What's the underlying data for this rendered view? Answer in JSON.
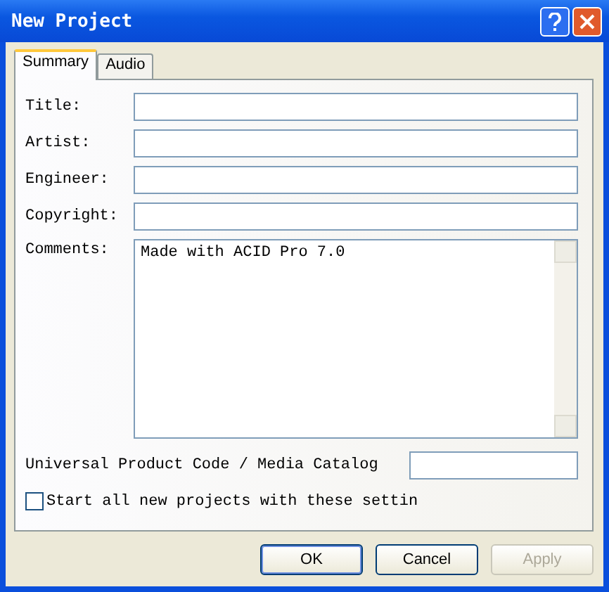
{
  "window": {
    "title": "New Project"
  },
  "tabs": [
    {
      "label": "Summary",
      "selected": true
    },
    {
      "label": "Audio",
      "selected": false
    }
  ],
  "fields": [
    {
      "label": "Title:"
    },
    {
      "label": "Artist:"
    },
    {
      "label": "Engineer:"
    },
    {
      "label": "Copyright:"
    }
  ],
  "comments": {
    "label": "Comments:",
    "value": "Made with ACID Pro 7.0"
  },
  "upc": {
    "label": "Universal Product Code / Media Catalog"
  },
  "checkbox": {
    "label": "Start all new projects with these settin",
    "checked": false
  },
  "buttons": [
    {
      "label": "OK",
      "disabled": false,
      "default": true
    },
    {
      "label": "Cancel",
      "disabled": false,
      "default": false
    },
    {
      "label": "Apply",
      "disabled": true,
      "default": false
    }
  ]
}
